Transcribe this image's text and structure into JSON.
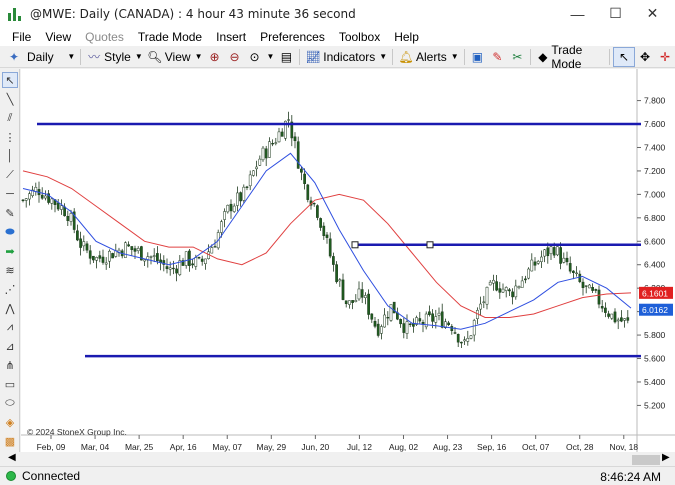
{
  "window": {
    "title": "@MWE: Daily (CANADA) : 4 hour 43 minute 36 second",
    "minimize_glyph": "—",
    "maximize_glyph": "☐",
    "close_glyph": "✕"
  },
  "menu": [
    {
      "label": "File",
      "enabled": true
    },
    {
      "label": "View",
      "enabled": true
    },
    {
      "label": "Quotes",
      "enabled": false
    },
    {
      "label": "Trade Mode",
      "enabled": true
    },
    {
      "label": "Insert",
      "enabled": true
    },
    {
      "label": "Preferences",
      "enabled": true
    },
    {
      "label": "Toolbox",
      "enabled": true
    },
    {
      "label": "Help",
      "enabled": true
    }
  ],
  "toolbar": {
    "interval": "Daily",
    "style_label": "Style",
    "view_label": "View",
    "indicators_label": "Indicators",
    "alerts_label": "Alerts",
    "trade_mode_label": "Trade Mode"
  },
  "chart": {
    "copyright": "© 2024 StoneX Group Inc.",
    "last_price_label": "6.1601",
    "ma_label": "6.0162",
    "last_price_color": "#e02020",
    "ma_label_color": "#1e5fd8"
  },
  "chart_data": {
    "type": "candlestick",
    "y_ticks": [
      "7.800",
      "7.600",
      "7.400",
      "7.200",
      "7.000",
      "6.800",
      "6.600",
      "6.400",
      "6.200",
      "6.000",
      "5.800",
      "5.600",
      "5.400",
      "5.200"
    ],
    "ylim": [
      5.05,
      7.95
    ],
    "x_ticks": [
      "Feb, 09",
      "Mar, 04",
      "Mar, 25",
      "Apr, 16",
      "May, 07",
      "May, 29",
      "Jun, 20",
      "Jul, 12",
      "Aug, 02",
      "Aug, 23",
      "Sep, 16",
      "Oct, 07",
      "Oct, 28",
      "Nov, 18"
    ],
    "horizontal_lines": [
      7.6,
      6.57,
      5.62
    ],
    "series": [
      {
        "color": "#e04040",
        "kind": "moving-average"
      },
      {
        "color": "#2f4fe0",
        "kind": "moving-average"
      }
    ],
    "anchor_closes": [
      6.95,
      7.05,
      6.95,
      6.85,
      6.55,
      6.45,
      6.5,
      6.55,
      6.5,
      6.45,
      6.35,
      6.45,
      6.4,
      6.6,
      6.9,
      7.0,
      7.3,
      7.45,
      7.65,
      7.1,
      6.85,
      6.4,
      6.05,
      6.15,
      5.85,
      6.05,
      5.85,
      5.9,
      5.95,
      5.9,
      5.7,
      6.05,
      6.25,
      6.15,
      6.3,
      6.45,
      6.55,
      6.35,
      6.2,
      6.1,
      5.95,
      5.9
    ],
    "ma_red": [
      7.2,
      7.15,
      7.05,
      6.9,
      6.75,
      6.6,
      6.55,
      6.55,
      6.45,
      6.4,
      6.5,
      6.75,
      6.95,
      7.0,
      6.95,
      6.75,
      6.5,
      6.25,
      6.05,
      5.95,
      5.95,
      5.98,
      6.05,
      6.12,
      6.15,
      6.16
    ],
    "ma_blue": [
      7.05,
      7.0,
      6.85,
      6.6,
      6.5,
      6.45,
      6.4,
      6.45,
      6.6,
      6.9,
      7.2,
      7.35,
      7.1,
      6.7,
      6.35,
      6.05,
      5.9,
      5.88,
      5.85,
      5.9,
      6.0,
      6.1,
      6.25,
      6.3,
      6.2,
      6.03
    ]
  },
  "status": {
    "connection": "Connected",
    "time": "8:46:24 AM"
  }
}
